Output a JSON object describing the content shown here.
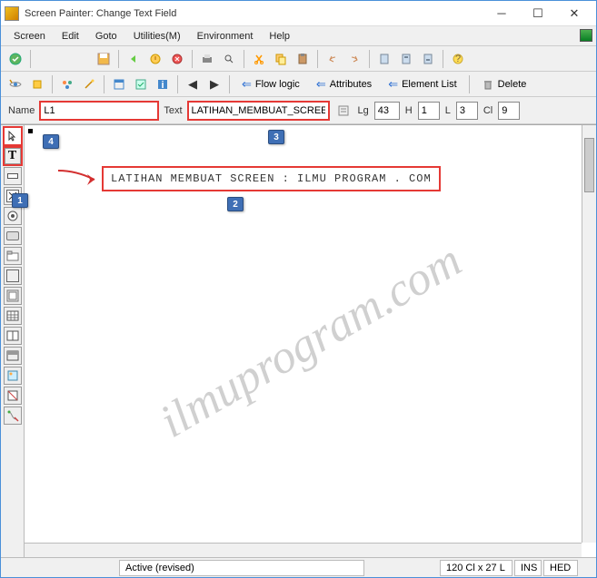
{
  "window": {
    "title": "Screen Painter: Change Text Field"
  },
  "menubar": {
    "items": [
      "Screen",
      "Edit",
      "Goto",
      "Utilities(M)",
      "Environment",
      "Help"
    ]
  },
  "toolbar2": {
    "flow_logic": "Flow logic",
    "attributes": "Attributes",
    "element_list": "Element List",
    "delete": "Delete"
  },
  "props": {
    "name_label": "Name",
    "name_value": "L1",
    "text_label": "Text",
    "text_value": "LATIHAN_MEMBUAT_SCREEN",
    "lg_label": "Lg",
    "lg_value": "43",
    "h_label": "H",
    "h_value": "1",
    "l_label": "L",
    "l_value": "3",
    "cl_label": "Cl",
    "cl_value": "9"
  },
  "canvas": {
    "text_content": "LATIHAN MEMBUAT SCREEN : ILMU PROGRAM . COM"
  },
  "badges": {
    "b1": "1",
    "b2": "2",
    "b3": "3",
    "b4": "4"
  },
  "watermark": "ilmuprogram.com",
  "status": {
    "active": "Active (revised)",
    "coords": "120 Cl x 27 L",
    "ins": "INS",
    "hed": "HED"
  }
}
